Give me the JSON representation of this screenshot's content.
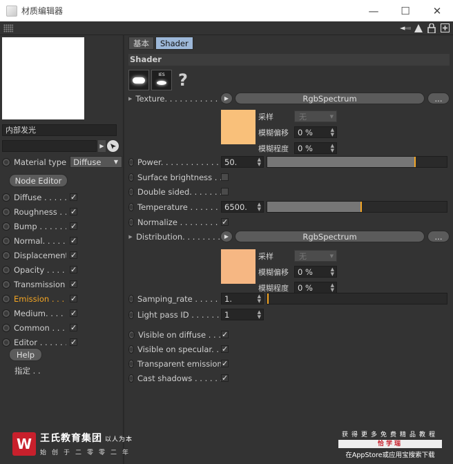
{
  "window": {
    "title": "材质编辑器",
    "minimize": "—",
    "maximize": "☐",
    "close": "✕"
  },
  "toolbar": {
    "icons": [
      "arrow-left-icon",
      "arrow-up-icon",
      "lock-icon",
      "add-window-icon"
    ]
  },
  "left": {
    "material_name": "内部发光",
    "material_type_label": "Material type",
    "material_type_value": "Diffuse",
    "node_editor_label": "Node Editor",
    "channels": [
      {
        "label": "Diffuse . . . . . .",
        "checked": true,
        "active": false
      },
      {
        "label": "Roughness . . . .",
        "checked": true,
        "active": false
      },
      {
        "label": "Bump . . . . . . .",
        "checked": true,
        "active": false
      },
      {
        "label": "Normal. . . . . . .",
        "checked": true,
        "active": false
      },
      {
        "label": "Displacement",
        "checked": true,
        "active": false
      },
      {
        "label": "Opacity . . . . . .",
        "checked": true,
        "active": false
      },
      {
        "label": "Transmission",
        "checked": true,
        "active": false
      },
      {
        "label": "Emission . . . .",
        "checked": true,
        "active": true
      },
      {
        "label": "Medium. . . . . .",
        "checked": true,
        "active": false
      },
      {
        "label": "Common . . . . .",
        "checked": true,
        "active": false
      },
      {
        "label": "Editor . . . . . .",
        "checked": true,
        "active": false
      }
    ],
    "help_label": "Help",
    "assign_label": "指定 . ."
  },
  "right": {
    "tabs": [
      {
        "label": "基本",
        "active": false
      },
      {
        "label": "Shader",
        "active": true
      }
    ],
    "section_title": "Shader",
    "help_mark": "?",
    "ies_label": "IES",
    "texture": {
      "label": "Texture. . . . . . . . . . . . .",
      "button": "RgbSpectrum",
      "more": "...",
      "swatch_color": "#f9c07a",
      "sample_label": "采样",
      "sample_value": "无",
      "blur_offset_label": "模糊偏移",
      "blur_offset_value": "0 %",
      "blur_scale_label": "模糊程度",
      "blur_scale_value": "0 %"
    },
    "power": {
      "label": "Power. . . . . . . . . . . . . .",
      "value": "50.",
      "fraction": 0.82
    },
    "surface_brightness": {
      "label": "Surface brightness . .",
      "checked": false
    },
    "double_sided": {
      "label": "Double sided. . . . . . . .",
      "checked": false
    },
    "temperature": {
      "label": "Temperature . . . . . . .",
      "value": "6500.",
      "fraction": 0.52
    },
    "normalize": {
      "label": "Normalize . . . . . . . . .",
      "checked": true
    },
    "distribution": {
      "label": "Distribution. . . . . . . .",
      "button": "RgbSpectrum",
      "more": "...",
      "swatch_color": "#f6b783",
      "sample_label": "采样",
      "sample_value": "无",
      "blur_offset_label": "模糊偏移",
      "blur_offset_value": "0 %",
      "blur_scale_label": "模糊程度",
      "blur_scale_value": "0 %"
    },
    "samping_rate": {
      "label": "Samping_rate . . . . . .",
      "value": "1.",
      "fraction": 0.0
    },
    "light_pass_id": {
      "label": "Light pass ID . . . . . . .",
      "value": "1"
    },
    "visible_on_diffuse": {
      "label": "Visible on diffuse . . .",
      "checked": true
    },
    "visible_on_specular": {
      "label": "Visible on specular. . .",
      "checked": true
    },
    "transparent_emission": {
      "label": "Transparent emission",
      "checked": true
    },
    "cast_shadows": {
      "label": "Cast shadows . . . . . . .",
      "checked": true
    }
  },
  "watermark": {
    "logo_letter": "W",
    "org_name": "王氏教育集团",
    "slogan": "以人为本",
    "founded": "始创于二零零二年",
    "right_line1": "获得更多免费精品教程",
    "right_line2": "恰学瑞",
    "right_line3": "在AppStore或应用宝搜索下载"
  },
  "colors": {
    "accent_orange": "#f5a623",
    "tab_active": "#9db8d9"
  }
}
